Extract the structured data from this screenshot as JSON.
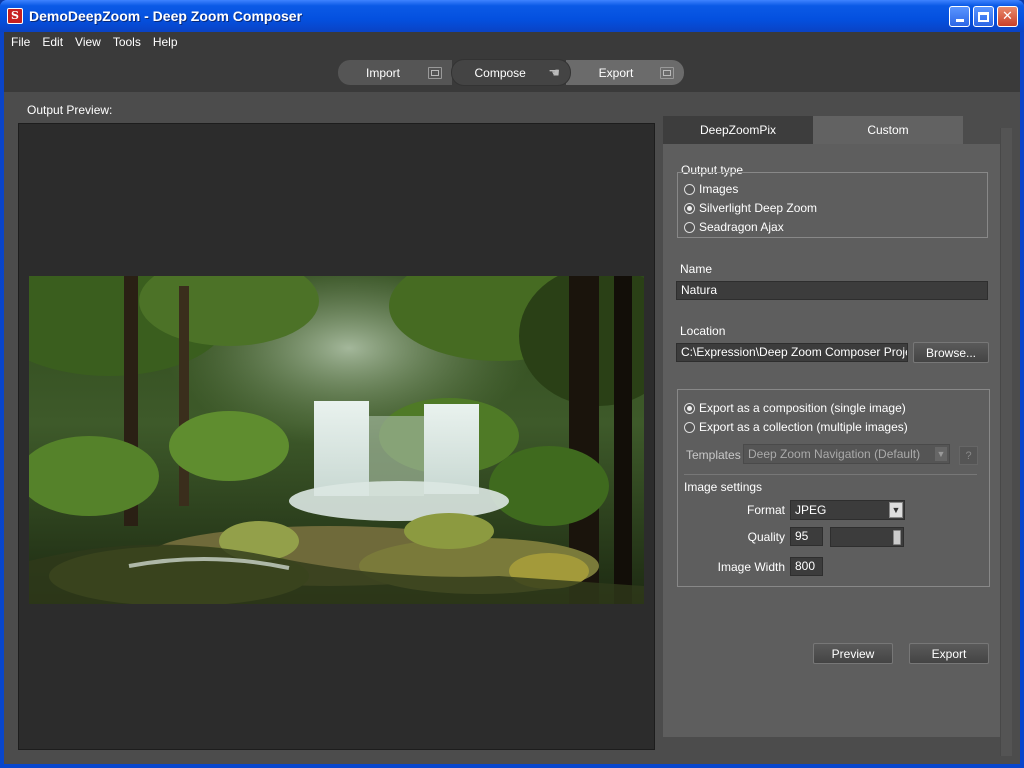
{
  "window": {
    "title": "DemoDeepZoom - Deep Zoom Composer",
    "app_icon_glyph": "S"
  },
  "menu": {
    "items": [
      "File",
      "Edit",
      "View",
      "Tools",
      "Help"
    ]
  },
  "workspace": {
    "import_label": "Import",
    "compose_label": "Compose",
    "export_label": "Export",
    "active": "Export"
  },
  "preview": {
    "label": "Output Preview:",
    "image_alt": "rainforest waterfall"
  },
  "tabs": {
    "deepzoompix": "DeepZoomPix",
    "custom": "Custom",
    "active": "Custom"
  },
  "output_type": {
    "legend": "Output type",
    "options": [
      "Images",
      "Silverlight Deep Zoom",
      "Seadragon Ajax"
    ],
    "selected": "Silverlight Deep Zoom"
  },
  "name": {
    "label": "Name",
    "value": "Natura"
  },
  "location": {
    "label": "Location",
    "value": "C:\\Expression\\Deep Zoom Composer Projects\\",
    "browse_label": "Browse..."
  },
  "export_mode": {
    "options": [
      "Export as a composition (single image)",
      "Export as a collection (multiple images)"
    ],
    "selected": "Export as a composition (single image)"
  },
  "templates": {
    "label": "Templates",
    "value": "Deep Zoom Navigation (Default)",
    "help_glyph": "?"
  },
  "image_settings": {
    "heading": "Image settings",
    "format_label": "Format",
    "format_value": "JPEG",
    "quality_label": "Quality",
    "quality_value": "95",
    "image_width_label": "Image Width",
    "image_width_value": "800"
  },
  "actions": {
    "preview_label": "Preview",
    "export_label": "Export"
  }
}
